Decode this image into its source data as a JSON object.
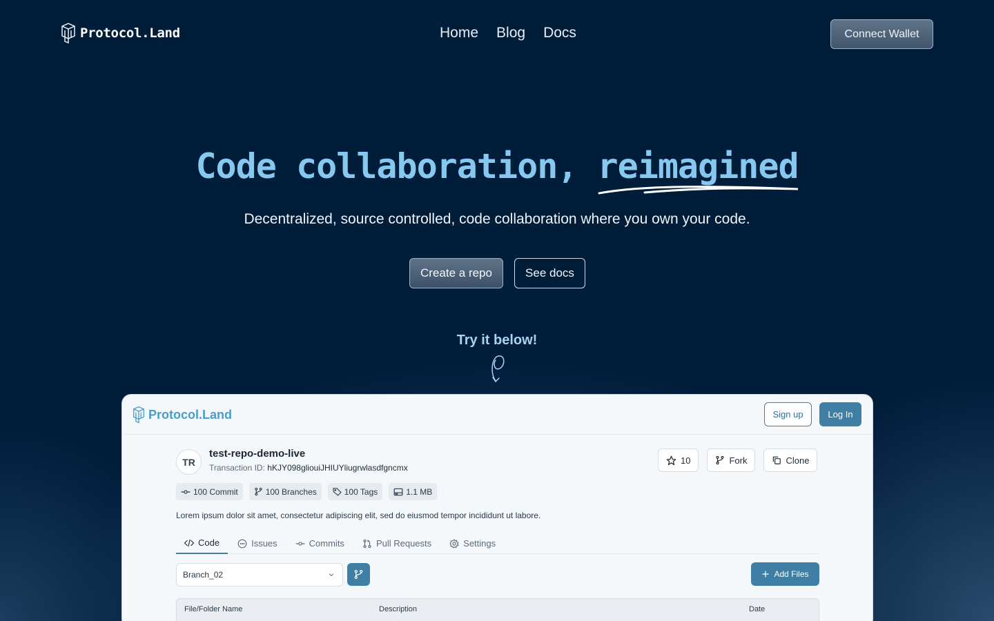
{
  "nav": {
    "brand": "Protocol.Land",
    "links": [
      "Home",
      "Blog",
      "Docs"
    ],
    "connect_label": "Connect Wallet"
  },
  "hero": {
    "title_main": "Code collaboration, ",
    "title_accent": "reimagined",
    "subtitle": "Decentralized, source controlled, code collaboration where you own your code.",
    "primary_cta": "Create a repo",
    "secondary_cta": "See docs",
    "try_text": "Try it below!"
  },
  "app": {
    "brand": "Protocol.Land",
    "signup_label": "Sign up",
    "login_label": "Log In",
    "repo": {
      "avatar": "TR",
      "name": "test-repo-demo-live",
      "tx_label": "Transaction ID: ",
      "tx_id": "hKJY098gliouiJHIUYliugrwlasdfgncmx",
      "description": "Lorem ipsum dolor sit amet, consectetur adipiscing elit, sed do eiusmod tempor incididunt ut labore."
    },
    "actions": {
      "star_count": "10",
      "fork_label": "Fork",
      "clone_label": "Clone"
    },
    "stats": {
      "commits": "100 Commit",
      "branches": "100 Branches",
      "tags": "100 Tags",
      "size": "1.1 MB"
    },
    "tabs": [
      "Code",
      "Issues",
      "Commits",
      "Pull Requests",
      "Settings"
    ],
    "branch_value": "Branch_02",
    "add_files_label": "Add Files",
    "table_headers": [
      "File/Folder Name",
      "Description",
      "Date"
    ]
  },
  "colors": {
    "background": "#001d3a",
    "title_accent": "#86c8ef",
    "brand_blue": "#3f7fa5"
  }
}
